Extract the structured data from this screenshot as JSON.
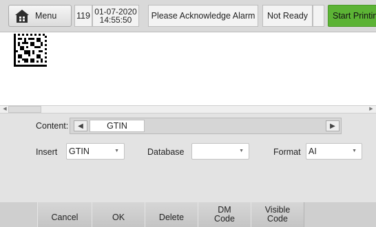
{
  "topbar": {
    "menu_label": "Menu",
    "count": "119",
    "date": "01-07-2020",
    "time": "14:55:50",
    "alarm": "Please Acknowledge Alarm",
    "status": "Not Ready",
    "start_label": "Start Printing",
    "start_color": "#5cb335"
  },
  "content": {
    "label": "Content:",
    "value": "GTIN"
  },
  "fields": {
    "insert_label": "Insert",
    "insert_value": "GTIN",
    "database_label": "Database",
    "database_value": "",
    "format_label": "Format",
    "format_value": "AI"
  },
  "buttons": {
    "cancel": "Cancel",
    "ok": "OK",
    "delete": "Delete",
    "dm_line1": "DM",
    "dm_line2": "Code",
    "visible_line1": "Visible",
    "visible_line2": "Code"
  },
  "icons": {
    "menu": "home-icon",
    "prev": "triangle-left-icon",
    "next": "triangle-right-icon",
    "dropdown": "chevron-down-icon"
  }
}
